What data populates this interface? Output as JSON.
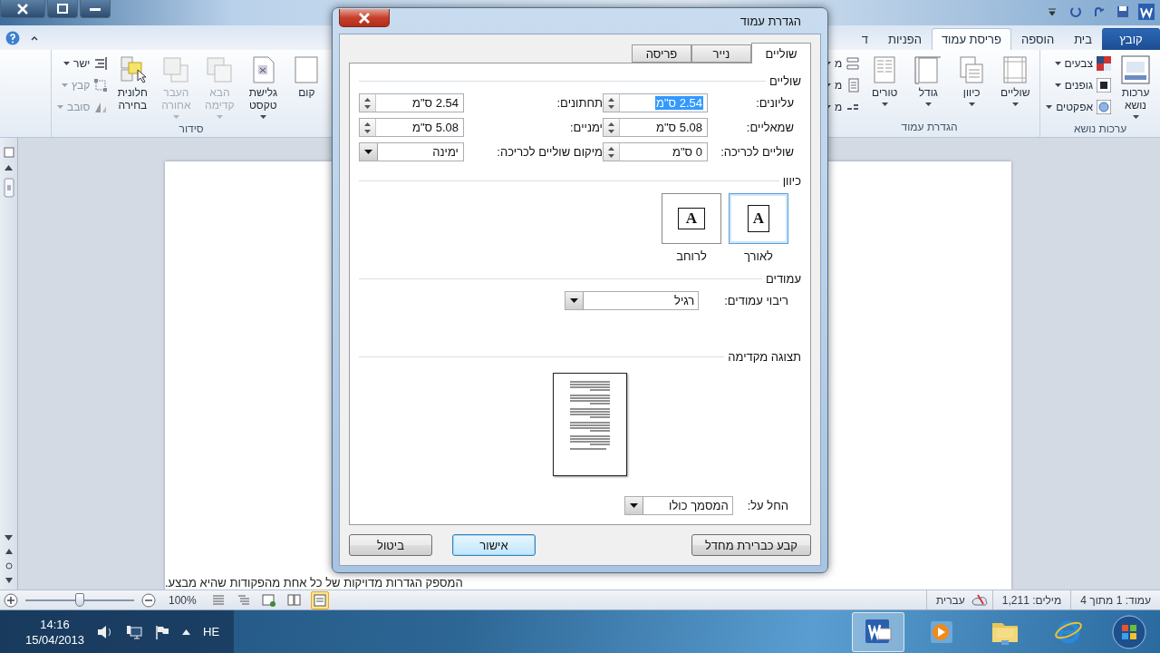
{
  "ribbon": {
    "tabs": [
      {
        "label": "קובץ",
        "kind": "file",
        "selected": false
      },
      {
        "label": "בית",
        "kind": "tab",
        "selected": false
      },
      {
        "label": "הוספה",
        "kind": "tab",
        "selected": false
      },
      {
        "label": "פריסת עמוד",
        "kind": "tab",
        "selected": true
      },
      {
        "label": "הפניות",
        "kind": "tab",
        "selected": false
      },
      {
        "label": "ד",
        "kind": "tab",
        "selected": false
      }
    ],
    "groups_right": [
      {
        "title": "ערכות נושא",
        "items": [
          {
            "kind": "big",
            "label": "ערכות נושא",
            "caret": true,
            "disabled": false
          },
          {
            "kind": "small",
            "label": "צבעים",
            "disabled": false
          },
          {
            "kind": "small",
            "label": "גופנים",
            "disabled": false
          },
          {
            "kind": "small",
            "label": "אפקטים",
            "disabled": false
          }
        ]
      },
      {
        "title": "הגדרת עמוד",
        "items": [
          {
            "kind": "big",
            "label": "שוליים",
            "caret": true,
            "disabled": false
          },
          {
            "kind": "big",
            "label": "כיוון",
            "caret": true,
            "disabled": false
          },
          {
            "kind": "big",
            "label": "גודל",
            "caret": true,
            "disabled": false
          },
          {
            "kind": "big",
            "label": "טורים",
            "caret": true,
            "disabled": false
          },
          {
            "kind": "small",
            "label": "מ",
            "disabled": false
          },
          {
            "kind": "small",
            "label": "מ",
            "disabled": false
          },
          {
            "kind": "small",
            "label": "מ",
            "disabled": false
          }
        ]
      }
    ],
    "groups_left": [
      {
        "title": "סידור",
        "items": [
          {
            "kind": "big",
            "label": "קום",
            "caret": false,
            "disabled": false
          },
          {
            "kind": "big",
            "label": "גלישת טקסט",
            "caret": true,
            "disabled": false
          },
          {
            "kind": "big",
            "label": "הבא קדימה",
            "caret": true,
            "disabled": true
          },
          {
            "kind": "big",
            "label": "העבר אחורה",
            "caret": true,
            "disabled": true
          },
          {
            "kind": "big",
            "label": "חלונית בחירה",
            "caret": false,
            "disabled": false
          },
          {
            "kind": "small",
            "label": "ישר",
            "disabled": false
          },
          {
            "kind": "small",
            "label": "קבץ",
            "disabled": true
          },
          {
            "kind": "small",
            "label": "סובב",
            "disabled": true
          }
        ]
      }
    ]
  },
  "document": {
    "text_line": "המספק הגדרות מדויקות של כל אחת מהפקודות שהיא מבצע."
  },
  "dialog": {
    "title": "הגדרת עמוד",
    "tabs": [
      {
        "label": "שוליים",
        "selected": true
      },
      {
        "label": "נייר",
        "selected": false
      },
      {
        "label": "פריסה",
        "selected": false
      }
    ],
    "margins": {
      "heading": "שוליים",
      "fields": [
        {
          "label": "עליונים:",
          "value": "2.54 ס\"מ",
          "kind": "spin",
          "selected": true
        },
        {
          "label": "תחתונים:",
          "value": "2.54 ס\"מ",
          "kind": "spin",
          "selected": false
        },
        {
          "label": "שמאליים:",
          "value": "5.08 ס\"מ",
          "kind": "spin",
          "selected": false
        },
        {
          "label": "ימניים:",
          "value": "5.08 ס\"מ",
          "kind": "spin",
          "selected": false
        },
        {
          "label": "שוליים לכריכה:",
          "value": "0 ס\"מ",
          "kind": "spin",
          "selected": false
        },
        {
          "label": "מיקום שוליים לכריכה:",
          "value": "ימינה",
          "kind": "dropdown",
          "selected": false
        }
      ]
    },
    "orientation": {
      "heading": "כיוון",
      "options": [
        {
          "label": "לאורך",
          "glyph": "A",
          "kind": "portrait",
          "selected": true
        },
        {
          "label": "לרוחב",
          "glyph": "A",
          "kind": "landscape",
          "selected": false
        }
      ]
    },
    "pages": {
      "heading": "עמודים",
      "label": "ריבוי עמודים:",
      "value": "רגיל"
    },
    "preview": {
      "heading": "תצוגה מקדימה",
      "apply_label": "החל על:",
      "apply_value": "המסמך כולו"
    },
    "buttons": [
      {
        "label": "קבע כברירת מחדל",
        "kind": "set-default",
        "selected": false
      },
      {
        "label": "אישור",
        "kind": "ok",
        "selected": true
      },
      {
        "label": "ביטול",
        "kind": "cancel",
        "selected": false
      }
    ]
  },
  "status_bar": {
    "page": "עמוד: 1 מתוך 4",
    "words": "מילים: 1,211",
    "language": "עברית",
    "zoom": "100%",
    "zoom_slider": {
      "level": 0.5
    },
    "views": [
      {
        "kind": "draft",
        "selected": false
      },
      {
        "kind": "outline",
        "selected": false
      },
      {
        "kind": "web",
        "selected": false
      },
      {
        "kind": "reading",
        "selected": false
      },
      {
        "kind": "print",
        "selected": true
      }
    ]
  },
  "taskbar": {
    "language": "HE",
    "time": "14:16",
    "date": "15/04/2013",
    "apps": [
      {
        "kind": "word",
        "selected": true
      },
      {
        "kind": "media",
        "selected": false
      },
      {
        "kind": "folder",
        "selected": false
      },
      {
        "kind": "browser",
        "selected": false
      }
    ]
  }
}
